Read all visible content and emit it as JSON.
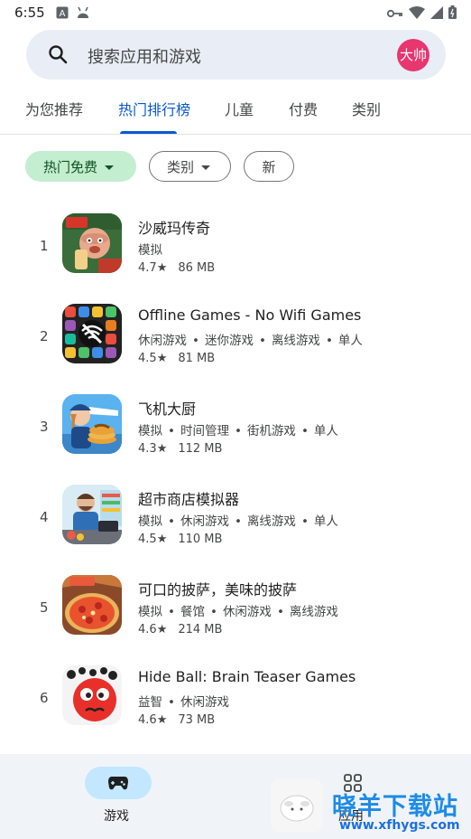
{
  "status_bar": {
    "time": "6:55",
    "left_icons": [
      "a-box-icon",
      "android-icon"
    ],
    "right_icons": [
      "vpn-key-icon",
      "wifi-icon",
      "signal-icon",
      "battery-icon"
    ]
  },
  "search": {
    "placeholder": "搜索应用和游戏",
    "avatar_text": "大帅",
    "avatar_color": "#e8366f"
  },
  "tabs": [
    {
      "label": "为您推荐",
      "active": false
    },
    {
      "label": "热门排行榜",
      "active": true
    },
    {
      "label": "儿童",
      "active": false
    },
    {
      "label": "付费",
      "active": false
    },
    {
      "label": "类别",
      "active": false
    }
  ],
  "chips": [
    {
      "label": "热门免费",
      "selected": true,
      "dropdown": true
    },
    {
      "label": "类别",
      "selected": false,
      "dropdown": true
    },
    {
      "label": "新",
      "selected": false,
      "dropdown": false
    }
  ],
  "apps": [
    {
      "rank": "1",
      "name": "沙威玛传奇",
      "categories": [
        "模拟"
      ],
      "rating": "4.7",
      "size": "86 MB",
      "icon": "shawarma-legend-icon"
    },
    {
      "rank": "2",
      "name": "Offline Games - No Wifi Games",
      "categories": [
        "休闲游戏",
        "迷你游戏",
        "离线游戏",
        "单人"
      ],
      "rating": "4.5",
      "size": "81 MB",
      "icon": "offline-games-icon"
    },
    {
      "rank": "3",
      "name": "飞机大厨",
      "categories": [
        "模拟",
        "时间管理",
        "街机游戏",
        "单人"
      ],
      "rating": "4.3",
      "size": "112 MB",
      "icon": "airplane-chef-icon"
    },
    {
      "rank": "4",
      "name": "超市商店模拟器",
      "categories": [
        "模拟",
        "休闲游戏",
        "离线游戏",
        "单人"
      ],
      "rating": "4.5",
      "size": "110 MB",
      "icon": "supermarket-simulator-icon"
    },
    {
      "rank": "5",
      "name": "可口的披萨，美味的披萨",
      "categories": [
        "模拟",
        "餐馆",
        "休闲游戏",
        "离线游戏"
      ],
      "rating": "4.6",
      "size": "214 MB",
      "icon": "pizza-icon"
    },
    {
      "rank": "6",
      "name": "Hide Ball: Brain Teaser Games",
      "categories": [
        "益智",
        "休闲游戏"
      ],
      "rating": "4.6",
      "size": "73 MB",
      "icon": "hide-ball-icon"
    }
  ],
  "star": "★",
  "bottom_nav": [
    {
      "label": "游戏",
      "active": true,
      "icon": "gamepad-icon"
    },
    {
      "label": "应用",
      "active": false,
      "icon": "apps-grid-icon"
    }
  ],
  "watermark": {
    "text": "晓羊下载站",
    "url": "www.xfhygs.com"
  },
  "colors": {
    "accent": "#0b57d0",
    "chip_selected_bg": "#c4eed0",
    "nav_pill": "#c2e7ff",
    "search_bg": "#e9eef6"
  }
}
